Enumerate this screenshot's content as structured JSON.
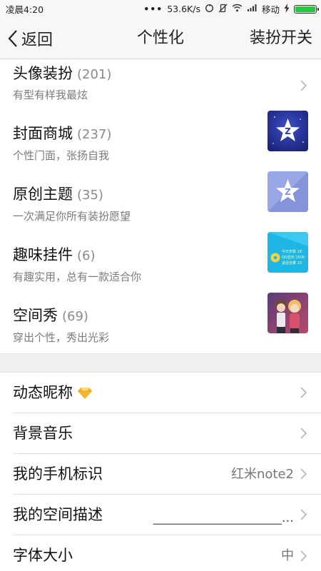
{
  "status_bar": {
    "time": "凌晨4:20",
    "dots": "•••",
    "network_speed": "53.6K/s",
    "carrier": "移动",
    "battery_color": "#28c840",
    "icons": [
      "sync-icon",
      "vibrate-off-icon",
      "wifi-icon",
      "signal-icon",
      "charging-icon",
      "battery-icon"
    ]
  },
  "nav": {
    "back_label": "返回",
    "title": "个性化",
    "action_label": "装扮开关"
  },
  "rich_items": [
    {
      "title": "头像装扮",
      "count": "(201)",
      "subtitle": "有型有样我最炫",
      "trailing": "chevron"
    },
    {
      "title": "封面商城",
      "count": "(237)",
      "subtitle": "个性门面，张扬自我",
      "trailing": "cover-shop-thumbnail"
    },
    {
      "title": "原创主题",
      "count": "(35)",
      "subtitle": "一次满足你所有装扮愿望",
      "trailing": "theme-thumbnail"
    },
    {
      "title": "趣味挂件",
      "count": "(6)",
      "subtitle": "有趣实用，总有一款适合你",
      "trailing": "widget-thumbnail"
    },
    {
      "title": "空间秀",
      "count": "(69)",
      "subtitle": "穿出个性，秀出光彩",
      "trailing": "space-show-thumbnail"
    }
  ],
  "widget_thumb_text": [
    "今日步数 18",
    "QQ音乐 2500",
    "谈话音量 10"
  ],
  "settings_items": [
    {
      "label": "动态昵称",
      "value": "",
      "icon": "diamond-icon"
    },
    {
      "label": "背景音乐",
      "value": ""
    },
    {
      "label": "我的手机标识",
      "value": "红米note2"
    },
    {
      "label": "我的空间描述",
      "value": "____________________..."
    },
    {
      "label": "字体大小",
      "value": "中"
    }
  ],
  "colors": {
    "accent_blue": "#2b3aa8",
    "diamond_gold": "#f5b330",
    "section_gap": "#f0f0f0"
  }
}
